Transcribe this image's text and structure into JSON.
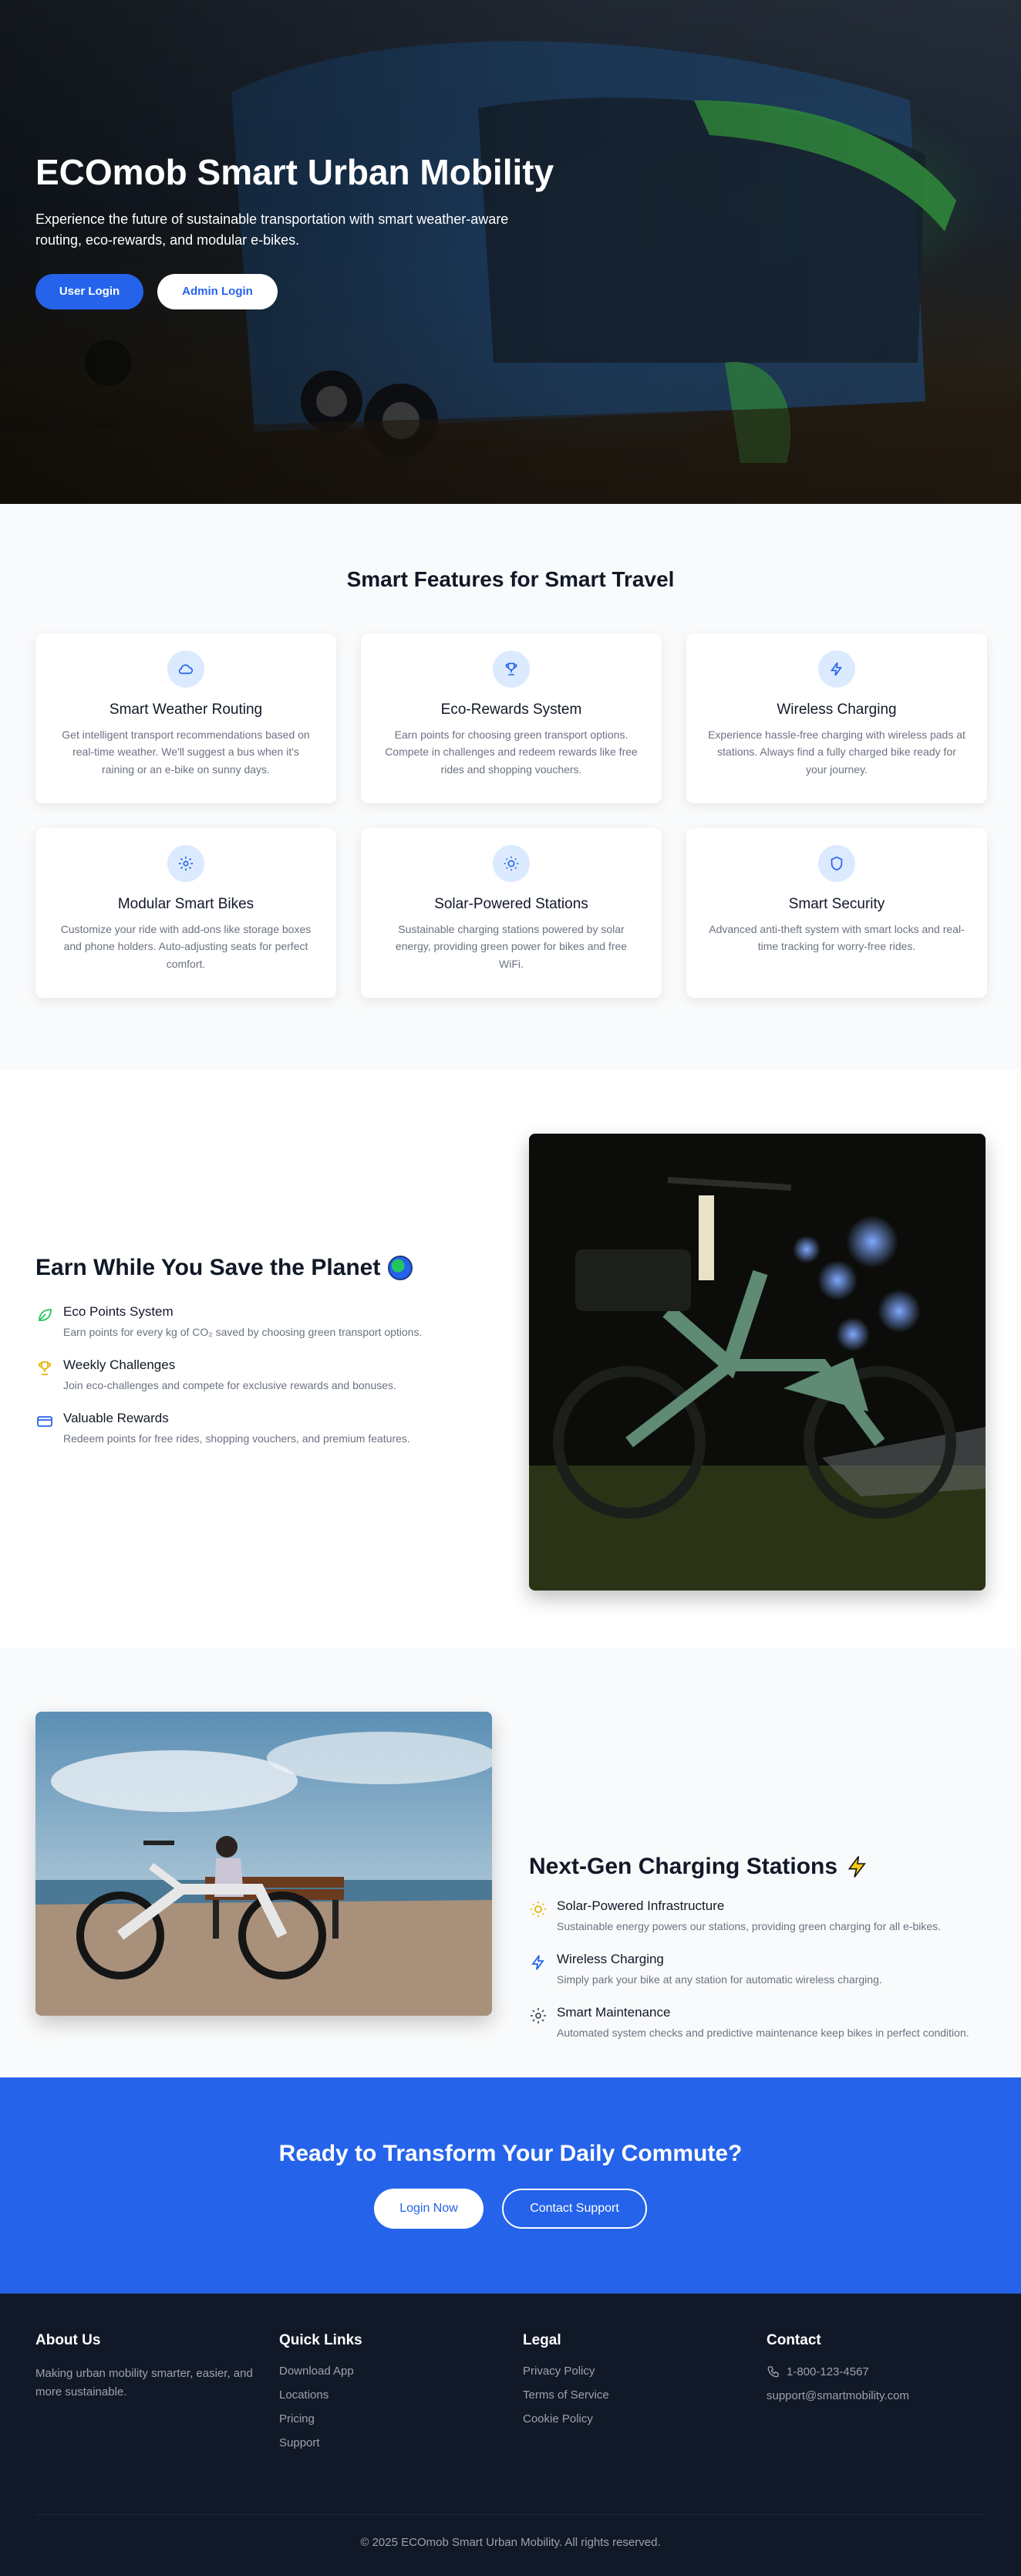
{
  "hero": {
    "title": "ECOmob Smart Urban Mobility",
    "subtitle": "Experience the future of sustainable transportation with smart weather-aware routing, eco-rewards, and modular e-bikes.",
    "user_login": "User Login",
    "admin_login": "Admin Login"
  },
  "features": {
    "heading": "Smart Features for Smart Travel",
    "cards": [
      {
        "icon": "cloud-icon",
        "title": "Smart Weather Routing",
        "desc": "Get intelligent transport recommendations based on real-time weather. We'll suggest a bus when it's raining or an e-bike on sunny days."
      },
      {
        "icon": "trophy-icon",
        "title": "Eco-Rewards System",
        "desc": "Earn points for choosing green transport options. Compete in challenges and redeem rewards like free rides and shopping vouchers."
      },
      {
        "icon": "lightning-icon",
        "title": "Wireless Charging",
        "desc": "Experience hassle-free charging with wireless pads at stations. Always find a fully charged bike ready for your journey."
      },
      {
        "icon": "gear-icon",
        "title": "Modular Smart Bikes",
        "desc": "Customize your ride with add-ons like storage boxes and phone holders. Auto-adjusting seats for perfect comfort."
      },
      {
        "icon": "sun-icon",
        "title": "Solar-Powered Stations",
        "desc": "Sustainable charging stations powered by solar energy, providing green power for bikes and free WiFi."
      },
      {
        "icon": "shield-icon",
        "title": "Smart Security",
        "desc": "Advanced anti-theft system with smart locks and real-time tracking for worry-free rides."
      }
    ]
  },
  "earn": {
    "heading": "Earn While You Save the Planet",
    "items": [
      {
        "icon": "leaf-icon",
        "title": "Eco Points System",
        "desc": "Earn points for every kg of CO₂ saved by choosing green transport options."
      },
      {
        "icon": "trophy-icon",
        "title": "Weekly Challenges",
        "desc": "Join eco-challenges and compete for exclusive rewards and bonuses."
      },
      {
        "icon": "credit-card-icon",
        "title": "Valuable Rewards",
        "desc": "Redeem points for free rides, shopping vouchers, and premium features."
      }
    ]
  },
  "charging": {
    "heading": "Next-Gen Charging Stations",
    "items": [
      {
        "icon": "sun-icon",
        "title": "Solar-Powered Infrastructure",
        "desc": "Sustainable energy powers our stations, providing green charging for all e-bikes."
      },
      {
        "icon": "lightning-icon",
        "title": "Wireless Charging",
        "desc": "Simply park your bike at any station for automatic wireless charging."
      },
      {
        "icon": "gear-icon",
        "title": "Smart Maintenance",
        "desc": "Automated system checks and predictive maintenance keep bikes in perfect condition."
      }
    ]
  },
  "cta": {
    "heading": "Ready to Transform Your Daily Commute?",
    "login": "Login Now",
    "support": "Contact Support"
  },
  "footer": {
    "about_head": "About Us",
    "about_text": "Making urban mobility smarter, easier, and more sustainable.",
    "links_head": "Quick Links",
    "links": [
      "Download App",
      "Locations",
      "Pricing",
      "Support"
    ],
    "legal_head": "Legal",
    "legal": [
      "Privacy Policy",
      "Terms of Service",
      "Cookie Policy"
    ],
    "contact_head": "Contact",
    "phone": "1-800-123-4567",
    "email": "support@smartmobility.com",
    "copyright": "© 2025 ECOmob Smart Urban Mobility. All rights reserved."
  },
  "colors": {
    "primary": "#2563eb",
    "footer": "#111827",
    "light_bg": "#f9fafb",
    "icon_bg": "#dbeafe"
  }
}
